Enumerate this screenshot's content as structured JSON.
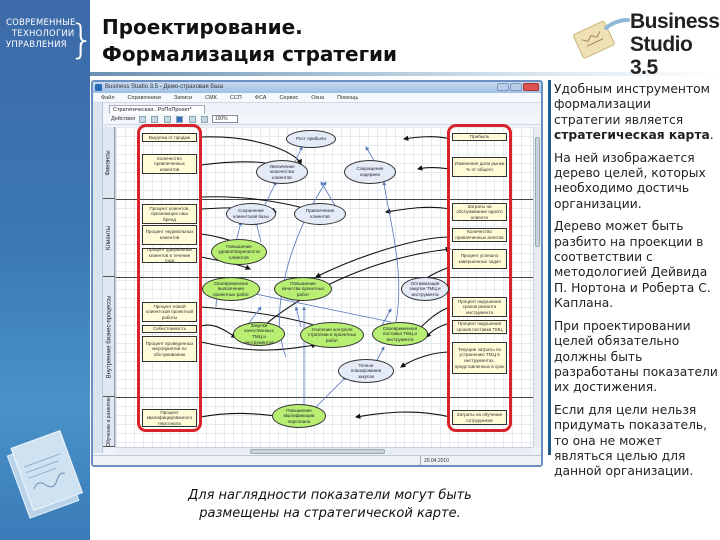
{
  "logo_left": {
    "lines": [
      "СОВРЕМЕННЫЕ",
      "ТЕХНОЛОГИИ",
      "УПРАВЛЕНИЯ"
    ]
  },
  "header": {
    "title_line1": "Проектирование.",
    "title_line2": "Формализация стратегии"
  },
  "brand": {
    "line1": "Business",
    "line2": "Studio 3.5"
  },
  "right_text": {
    "p1_prefix": "Удобным инструментом формализации стратегии является ",
    "p1_bold": "стратегическая карта",
    "p1_suffix": ".",
    "p2": "На ней изображается дерево целей, которых необходимо достичь организации.",
    "p3": "Дерево может быть разбито на проекции в соответствии с методологией Дейвида П. Нортона и Роберта С. Каплана.",
    "p4": "При проектировании целей обязательно должны быть разработаны показатели их достижения.",
    "p5": "Если для цели нельзя придумать показатель, то она не может являться целью для данной организации."
  },
  "caption": {
    "line1": "Для наглядности показатели могут быть",
    "line2": "размещены на стратегической карте."
  },
  "app": {
    "title": "Business Studio 3.5 - Демо-страховая база",
    "menu": [
      "Файл",
      "Справочники",
      "Записи",
      "СМК",
      "ССП",
      "ФСА",
      "Сервис",
      "Окна",
      "Помощь"
    ],
    "doc_tab": "Стратегическая...РоПоПроект*",
    "toolbar_actions_label": "Действия",
    "zoom_value": "100%",
    "status_date": "20.04.2010",
    "lanes": [
      "Финансы",
      "Клиенты",
      "Внутренние бизнес-процессы",
      "Обучение и развитие"
    ],
    "left_indicators": [
      "Выручка от продаж",
      "Количество привлеченных клиентов",
      "Процент клиентов, признающих наш бренд",
      "Процент недовольных клиентов",
      "Процент удержанных клиентов в течение года",
      "Процент новой клиентской проектной работы",
      "Себестоимость",
      "Процент проведенных мероприятий по обслуживанию",
      "Процент квалифицированного персонала"
    ],
    "right_indicators": [
      "Прибыль",
      "Изменение доли рынка % от общего",
      "Затраты на обслуживание одного клиента",
      "Количество привлеченных агентов",
      "Процент успешно завершенных задач",
      "Процент нарушения сроков ремонта инструмента",
      "Процент нарушения сроков поставки ТМЦ",
      "Текущие затраты по устранению ТМЦ в инструментах, представленных в срок",
      "Затраты на обучение сотрудников"
    ],
    "goals": [
      {
        "label": "Рост прибыли",
        "color": "blue"
      },
      {
        "label": "Увеличение количества клиентов",
        "color": "blue"
      },
      {
        "label": "Сокращение издержек",
        "color": "blue"
      },
      {
        "label": "Сохранение клиентской базы",
        "color": "blue"
      },
      {
        "label": "Привлечение клиентов",
        "color": "blue"
      },
      {
        "label": "Повышение удовлетворенности клиентов",
        "color": "green"
      },
      {
        "label": "Своевременное выполнение проектных работ",
        "color": "green"
      },
      {
        "label": "Повышение качества проектных работ",
        "color": "green"
      },
      {
        "label": "Оптимизация закупок ТМЦ и инструмента",
        "color": "blue"
      },
      {
        "label": "Закупки качественных ТМЦ и инструментов",
        "color": "green"
      },
      {
        "label": "Усиление контроля стратегии и проектных работ",
        "color": "green"
      },
      {
        "label": "Своевременная поставка ТМЦ и инструмента",
        "color": "green"
      },
      {
        "label": "Точное планирование закупок",
        "color": "blue"
      },
      {
        "label": "Повышение квалификации персонала",
        "color": "green"
      }
    ]
  },
  "colors": {
    "highlight": "#d8232a",
    "goal_green": "#b8ef72",
    "goal_blue": "#e4ebf6",
    "indicator_bg": "#fefbd6",
    "band_blue": "#3a78b4"
  }
}
